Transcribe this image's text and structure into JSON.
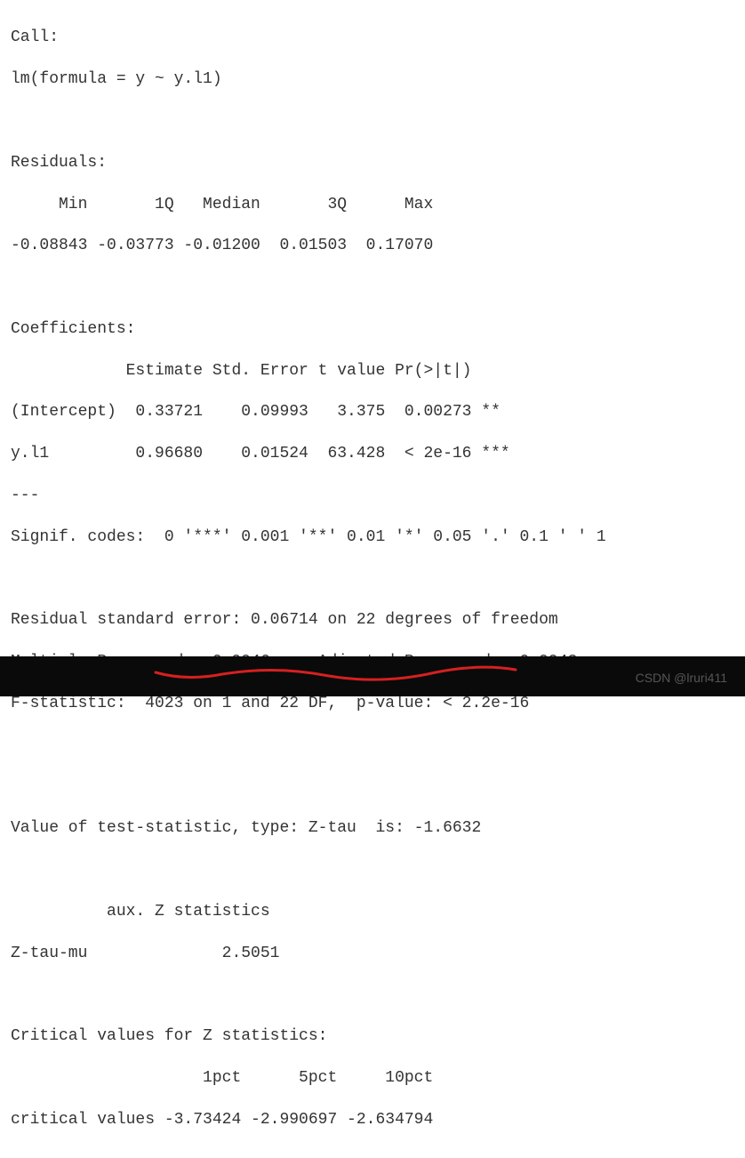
{
  "call_label": "Call:",
  "call_formula": "lm(formula = y ~ y.l1)",
  "residuals_label": "Residuals:",
  "residuals_headers": "     Min       1Q   Median       3Q      Max ",
  "residuals_values": "-0.08843 -0.03773 -0.01200  0.01503  0.17070 ",
  "coef_label": "Coefficients:",
  "coef_headers": "            Estimate Std. Error t value Pr(>|t|)    ",
  "coef_intercept": "(Intercept)  0.33721    0.09993   3.375  0.00273 ** ",
  "coef_yl1": "y.l1         0.96680    0.01524  63.428  < 2e-16 ***",
  "coef_sep": "---",
  "signif_codes": "Signif. codes:  0 '***' 0.001 '**' 0.01 '*' 0.05 '.' 0.1 ' ' 1",
  "rse": "Residual standard error: 0.06714 on 22 degrees of freedom",
  "rsq": "Multiple R-squared:  0.9946,\tAdjusted R-squared:  0.9943 ",
  "fstat": "F-statistic:  4023 on 1 and 22 DF,  p-value: < 2.2e-16",
  "teststat": "Value of test-statistic, type: Z-tau  is: -1.6632 ",
  "aux_header": "          aux. Z statistics",
  "aux_value": "Z-tau-mu              2.5051",
  "crit_label": "Critical values for Z statistics:",
  "crit_headers": "                    1pct      5pct     10pct",
  "crit_values": "critical values -3.73424 -2.990697 -2.634794",
  "watermark": "CSDN @lruri411"
}
